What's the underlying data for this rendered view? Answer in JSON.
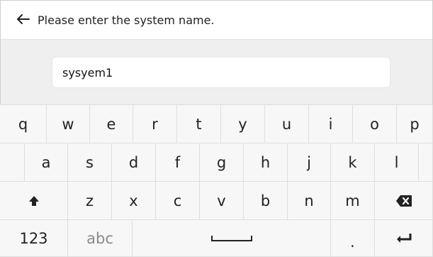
{
  "header": {
    "back_icon": "arrow-left-icon",
    "title": "Please enter the system name."
  },
  "input": {
    "value": "sysyem1"
  },
  "keyboard": {
    "row1": [
      "q",
      "w",
      "e",
      "r",
      "t",
      "y",
      "u",
      "i",
      "o",
      "p"
    ],
    "row2": [
      "a",
      "s",
      "d",
      "f",
      "g",
      "h",
      "j",
      "k",
      "l"
    ],
    "row3": [
      "z",
      "x",
      "c",
      "v",
      "b",
      "n",
      "m"
    ],
    "shift_icon": "shift-up-arrow-icon",
    "backspace_icon": "backspace-icon",
    "numbers_label": "123",
    "letters_label": "abc",
    "space_icon": "space-bar-icon",
    "period_label": ".",
    "enter_icon": "enter-return-icon"
  }
}
